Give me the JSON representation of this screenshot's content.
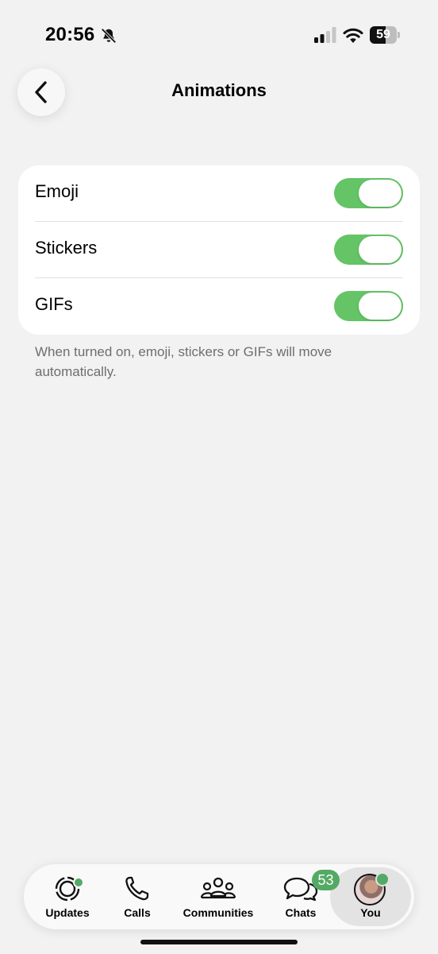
{
  "status_bar": {
    "time": "20:56",
    "battery_level": "59",
    "battery_fraction": 0.59,
    "icons": [
      "bell-slash-icon",
      "cellular-signal-icon",
      "wifi-icon",
      "battery-icon"
    ]
  },
  "header": {
    "title": "Animations",
    "back_icon": "chevron-left-icon"
  },
  "settings": {
    "rows": [
      {
        "label": "Emoji",
        "enabled": true
      },
      {
        "label": "Stickers",
        "enabled": true
      },
      {
        "label": "GIFs",
        "enabled": true
      }
    ],
    "footnote": "When turned on, emoji, stickers or GIFs will move automatically."
  },
  "tab_bar": {
    "tabs": [
      {
        "label": "Updates",
        "icon": "updates-icon",
        "has_dot": true
      },
      {
        "label": "Calls",
        "icon": "phone-icon"
      },
      {
        "label": "Communities",
        "icon": "communities-icon"
      },
      {
        "label": "Chats",
        "icon": "chats-icon",
        "badge": "53"
      },
      {
        "label": "You",
        "icon": "avatar",
        "active": true,
        "has_dot": true
      }
    ]
  },
  "colors": {
    "toggle_on": "#64c466",
    "accent": "#53aa64",
    "background": "#f2f2f2"
  }
}
